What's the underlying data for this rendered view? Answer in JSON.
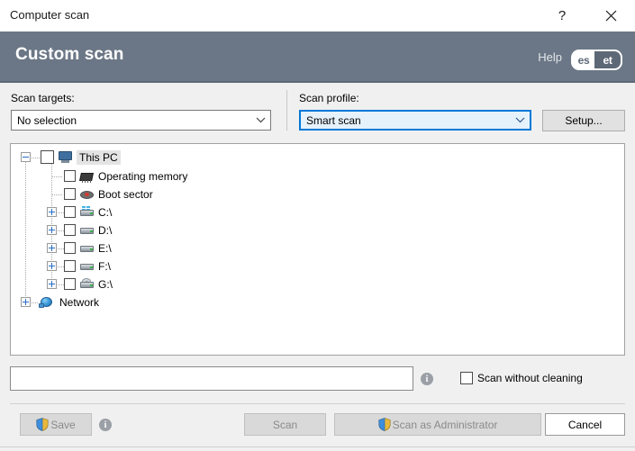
{
  "window": {
    "title": "Computer scan",
    "help_button": "?",
    "close_button": "✕"
  },
  "header": {
    "title": "Custom scan",
    "help_link": "Help",
    "logo_left": "es",
    "logo_right": "et",
    "background_color": "#6b7786"
  },
  "form": {
    "scan_targets_label": "Scan targets:",
    "scan_targets_value": "No selection",
    "scan_profile_label": "Scan profile:",
    "scan_profile_value": "Smart scan",
    "setup_button": "Setup...",
    "focus_color": "#0078d7"
  },
  "tree": {
    "nodes": [
      {
        "label": "This PC",
        "icon": "monitor-icon",
        "expander": "minus",
        "checkbox": true,
        "selected": true,
        "depth": 0
      },
      {
        "label": "Operating memory",
        "icon": "memory-icon",
        "expander": "none",
        "checkbox": true,
        "selected": false,
        "depth": 1
      },
      {
        "label": "Boot sector",
        "icon": "boot-sector-icon",
        "expander": "none",
        "checkbox": true,
        "selected": false,
        "depth": 1
      },
      {
        "label": "C:\\",
        "icon": "system-drive-icon",
        "expander": "plus",
        "checkbox": true,
        "selected": false,
        "depth": 1
      },
      {
        "label": "D:\\",
        "icon": "drive-icon",
        "expander": "plus",
        "checkbox": true,
        "selected": false,
        "depth": 1
      },
      {
        "label": "E:\\",
        "icon": "drive-icon",
        "expander": "plus",
        "checkbox": true,
        "selected": false,
        "depth": 1
      },
      {
        "label": "F:\\",
        "icon": "drive-icon",
        "expander": "plus",
        "checkbox": true,
        "selected": false,
        "depth": 1
      },
      {
        "label": "G:\\",
        "icon": "optical-drive-icon",
        "expander": "plus",
        "checkbox": true,
        "selected": false,
        "depth": 1
      },
      {
        "label": "Network",
        "icon": "network-icon",
        "expander": "plus",
        "checkbox": false,
        "selected": false,
        "depth": 0
      }
    ]
  },
  "options": {
    "path_field_value": "",
    "info_icon": "i",
    "scan_without_cleaning_label": "Scan without cleaning",
    "scan_without_cleaning_checked": false
  },
  "footer": {
    "save_button": "Save",
    "save_enabled": false,
    "save_info_icon": "i",
    "scan_button": "Scan",
    "scan_enabled": false,
    "scan_admin_button": "Scan as Administrator",
    "scan_admin_enabled": false,
    "cancel_button": "Cancel",
    "cancel_enabled": true
  }
}
